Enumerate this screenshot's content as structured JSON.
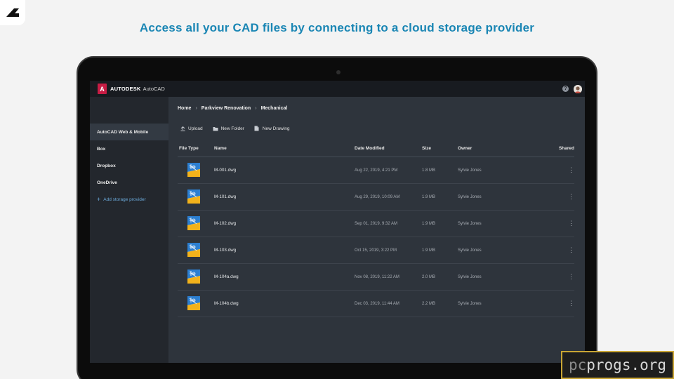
{
  "headline": "Access all your CAD files by connecting to a cloud storage provider",
  "app": {
    "brand_letter": "A",
    "brand": "AUTODESK",
    "product": "AutoCAD",
    "help_glyph": "?"
  },
  "sidebar": {
    "items": [
      {
        "label": "AutoCAD Web & Mobile",
        "active": true
      },
      {
        "label": "Box"
      },
      {
        "label": "Dropbox"
      },
      {
        "label": "OneDrive"
      }
    ],
    "add_label": "Add storage provider",
    "add_icon": "+"
  },
  "breadcrumb": [
    "Home",
    "Parkview Renovation",
    "Mechanical"
  ],
  "toolbar": {
    "upload": "Upload",
    "new_folder": "New Folder",
    "new_drawing": "New Drawing"
  },
  "table": {
    "headers": {
      "type": "File Type",
      "name": "Name",
      "date": "Date Modified",
      "size": "Size",
      "owner": "Owner",
      "shared": "Shared"
    },
    "rows": [
      {
        "name": "M-001.dwg",
        "date": "Aug 22, 2019, 4:21 PM",
        "size": "1.8 MB",
        "owner": "Sylvie Jones"
      },
      {
        "name": "M-101.dwg",
        "date": "Aug 29, 2019, 10:09 AM",
        "size": "1.9 MB",
        "owner": "Sylvie Jones"
      },
      {
        "name": "M-102.dwg",
        "date": "Sep 01, 2019, 9:32 AM",
        "size": "1.9 MB",
        "owner": "Sylvie Jones"
      },
      {
        "name": "M-103.dwg",
        "date": "Oct 15, 2019, 3:22 PM",
        "size": "1.9 MB",
        "owner": "Sylvie Jones"
      },
      {
        "name": "M-104a.dwg",
        "date": "Nov 08, 2019, 11:22 AM",
        "size": "2.0 MB",
        "owner": "Sylvie Jones"
      },
      {
        "name": "M-104b.dwg",
        "date": "Dec 03, 2019, 11:44 AM",
        "size": "2.2 MB",
        "owner": "Sylvie Jones"
      }
    ]
  },
  "watermark": {
    "pre": "pc",
    "main": "progs.org"
  },
  "colors": {
    "headline": "#1a86b4",
    "brand_red": "#c71c44",
    "link_blue": "#6aa8d8",
    "dwg_blue": "#2c7fd1",
    "dwg_yellow": "#f2b21b"
  }
}
